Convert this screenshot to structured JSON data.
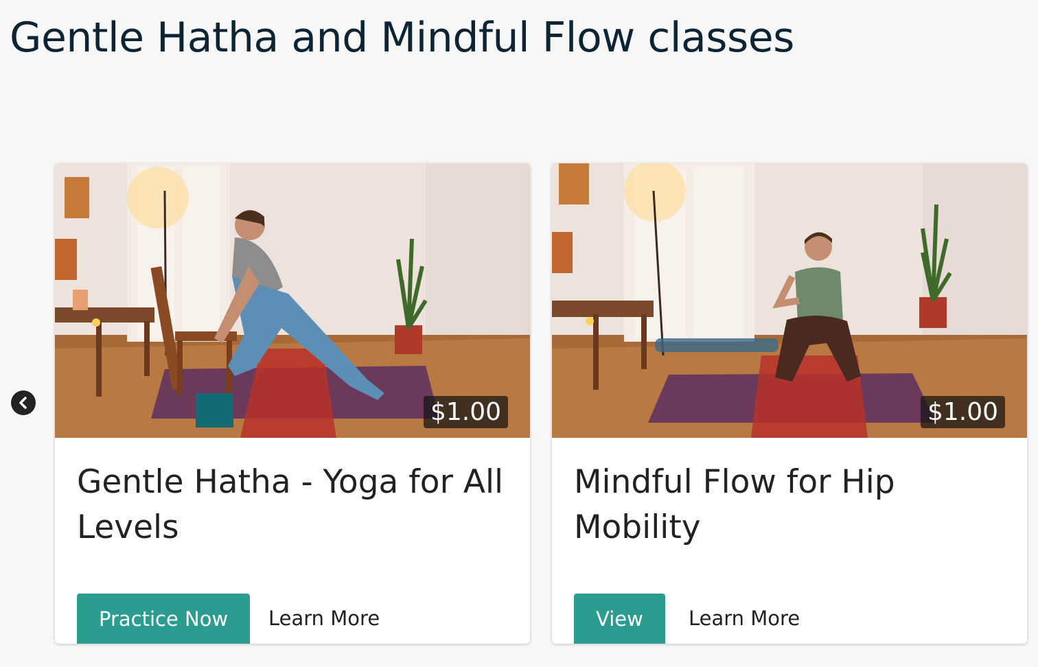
{
  "page": {
    "title": "Gentle Hatha and Mindful Flow classes"
  },
  "carousel": {
    "prev_icon": "chevron-left-icon"
  },
  "cards": [
    {
      "image_alt": "Woman in a lunge with hands on a wooden chair on a purple yoga mat",
      "price": "$1.00",
      "title": "Gentle Hatha - Yoga for All Levels",
      "primary_label": "Practice Now",
      "secondary_label": "Learn More"
    },
    {
      "image_alt": "Woman seated in a hip stretch pose on a purple yoga mat",
      "price": "$1.00",
      "title": "Mindful Flow for Hip Mobility",
      "primary_label": "View",
      "secondary_label": "Learn More"
    }
  ],
  "colors": {
    "accent": "#2a9d8f",
    "background": "#f7f7f7",
    "title": "#0d2434"
  }
}
